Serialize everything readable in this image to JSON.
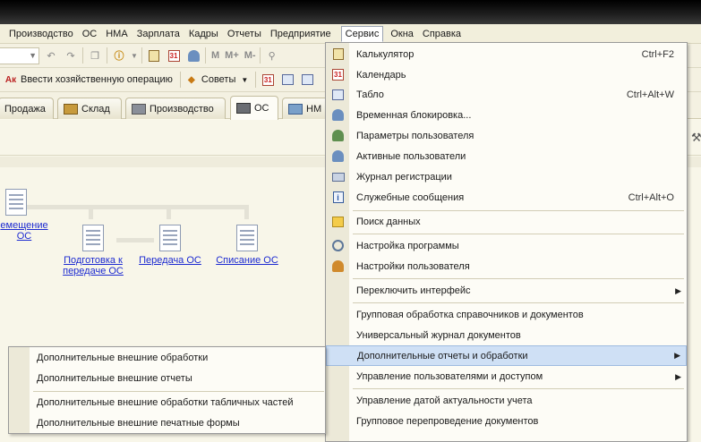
{
  "menubar": [
    "Производство",
    "ОС",
    "НМА",
    "Зарплата",
    "Кадры",
    "Отчеты",
    "Предприятие",
    "Сервис",
    "Окна",
    "Справка"
  ],
  "active_menu": "Сервис",
  "toolbar1": {
    "labels": [
      "M",
      "M+",
      "M-"
    ]
  },
  "toolbar2": {
    "enter_operation": "Ввести хозяйственную операцию",
    "tips": "Советы"
  },
  "tabs": [
    "Продажа",
    "Склад",
    "Производство",
    "ОС",
    "НМ"
  ],
  "flow": {
    "item_left": "емещение\nОС",
    "item_prep": "Подготовка к\nпередаче ОС",
    "item_transfer": "Передача ОС",
    "item_writeoff": "Списание ОС"
  },
  "service_menu": {
    "items": [
      {
        "label": "Калькулятор",
        "shortcut": "Ctrl+F2",
        "icon": "calculator-icon"
      },
      {
        "label": "Календарь",
        "shortcut": "",
        "icon": "calendar-icon"
      },
      {
        "label": "Табло",
        "shortcut": "Ctrl+Alt+W",
        "icon": "table-icon"
      },
      {
        "label": "Временная блокировка...",
        "shortcut": "",
        "icon": "lock-user-icon"
      },
      {
        "label": "Параметры пользователя",
        "shortcut": "",
        "icon": "user-settings-icon"
      },
      {
        "label": "Активные пользователи",
        "shortcut": "",
        "icon": "active-users-icon"
      },
      {
        "label": "Журнал регистрации",
        "shortcut": "",
        "icon": "log-icon"
      },
      {
        "label": "Служебные сообщения",
        "shortcut": "Ctrl+Alt+O",
        "icon": "messages-icon"
      },
      {
        "label": "Поиск данных",
        "shortcut": "",
        "icon": "search-data-icon"
      },
      {
        "label": "Настройка программы",
        "shortcut": "",
        "icon": "program-settings-icon"
      },
      {
        "label": "Настройки пользователя",
        "shortcut": "",
        "icon": "user-icon"
      },
      {
        "label": "Переключить интерфейс",
        "shortcut": "",
        "icon": ""
      },
      {
        "label": "Групповая обработка справочников и документов",
        "shortcut": "",
        "icon": ""
      },
      {
        "label": "Универсальный журнал документов",
        "shortcut": "",
        "icon": ""
      },
      {
        "label": "Дополнительные отчеты и обработки",
        "shortcut": "",
        "icon": ""
      },
      {
        "label": "Управление пользователями и доступом",
        "shortcut": "",
        "icon": ""
      },
      {
        "label": "Управление датой актуальности учета",
        "shortcut": "",
        "icon": ""
      },
      {
        "label": "Групповое перепроведение документов",
        "shortcut": "",
        "icon": ""
      }
    ]
  },
  "submenu": {
    "items": [
      "Дополнительные внешние обработки",
      "Дополнительные внешние отчеты",
      "Дополнительные внешние обработки табличных частей",
      "Дополнительные внешние печатные формы"
    ]
  },
  "colors": {
    "accent_highlight": "#cfe0f5",
    "link": "#1d2bd1"
  }
}
